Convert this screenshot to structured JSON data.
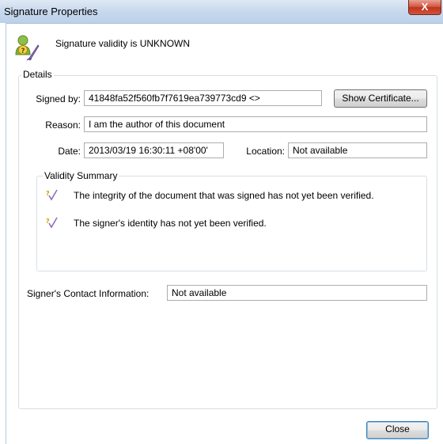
{
  "window": {
    "title": "Signature Properties",
    "close_glyph": "X"
  },
  "header": {
    "icon": "signature-unknown-icon",
    "status": "Signature validity is UNKNOWN"
  },
  "details": {
    "group_label": "Details",
    "signed_by_label": "Signed by:",
    "signed_by_value": "41848fa52f560fb7f7619ea739773cd9 <>",
    "show_certificate": "Show Certificate...",
    "reason_label": "Reason:",
    "reason_value": "I am the author of this document",
    "date_label": "Date:",
    "date_value": "2013/03/19 16:30:11 +08'00'",
    "location_label": "Location:",
    "location_value": "Not available"
  },
  "validity": {
    "group_label": "Validity Summary",
    "items": [
      {
        "icon": "question-check-icon",
        "text": "The integrity of the document that was signed has not yet been verified."
      },
      {
        "icon": "question-check-icon",
        "text": "The signer's identity has not yet been verified."
      }
    ]
  },
  "contact": {
    "label": "Signer's Contact Information:",
    "value": "Not available"
  },
  "footer": {
    "close_label": "Close"
  }
}
